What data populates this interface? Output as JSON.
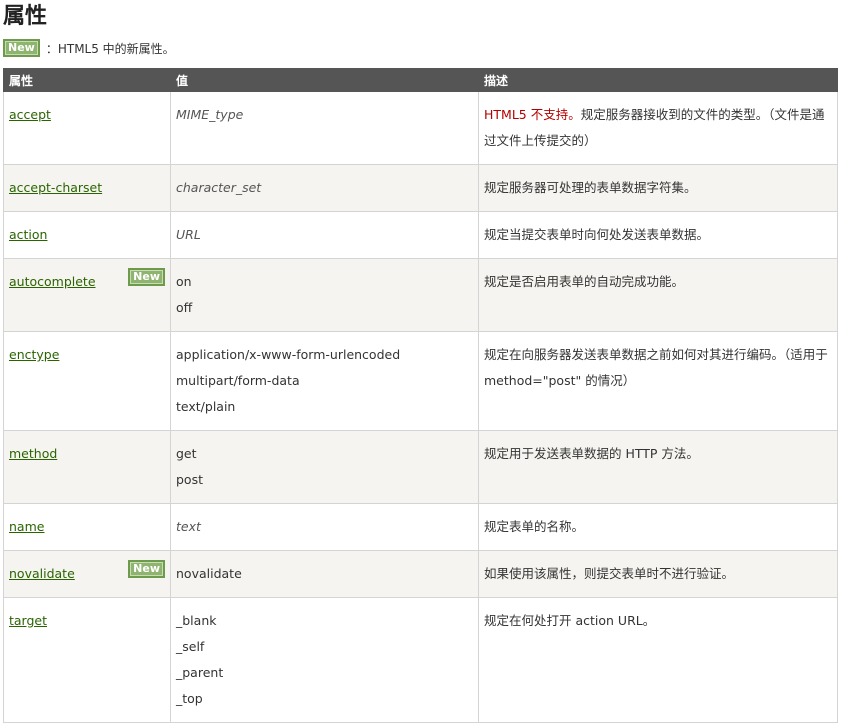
{
  "heading": "属性",
  "new_badge": "New",
  "note_text": "：HTML5 中的新属性。",
  "columns": [
    "属性",
    "值",
    "描述"
  ],
  "rows": [
    {
      "attr": "accept",
      "values": [
        "MIME_type"
      ],
      "italic": true,
      "desc_red": "HTML5 不支持。",
      "desc": "规定服务器接收到的文件的类型。（文件是通过文件上传提交的）",
      "is_new": false
    },
    {
      "attr": "accept-charset",
      "values": [
        "character_set"
      ],
      "italic": true,
      "desc_red": "",
      "desc": "规定服务器可处理的表单数据字符集。",
      "is_new": false
    },
    {
      "attr": "action",
      "values": [
        "URL"
      ],
      "italic": true,
      "desc_red": "",
      "desc": "规定当提交表单时向何处发送表单数据。",
      "is_new": false
    },
    {
      "attr": "autocomplete",
      "values": [
        "on",
        "off"
      ],
      "italic": false,
      "desc_red": "",
      "desc": "规定是否启用表单的自动完成功能。",
      "is_new": true
    },
    {
      "attr": "enctype",
      "values": [
        "application/x-www-form-urlencoded",
        "multipart/form-data",
        "text/plain"
      ],
      "italic": false,
      "desc_red": "",
      "desc": "规定在向服务器发送表单数据之前如何对其进行编码。（适用于 method=\"post\" 的情况）",
      "is_new": false
    },
    {
      "attr": "method",
      "values": [
        "get",
        "post"
      ],
      "italic": false,
      "desc_red": "",
      "desc": "规定用于发送表单数据的 HTTP 方法。",
      "is_new": false
    },
    {
      "attr": "name",
      "values": [
        "text"
      ],
      "italic": true,
      "desc_red": "",
      "desc": "规定表单的名称。",
      "is_new": false
    },
    {
      "attr": "novalidate",
      "values": [
        "novalidate"
      ],
      "italic": false,
      "desc_red": "",
      "desc": "如果使用该属性，则提交表单时不进行验证。",
      "is_new": true
    },
    {
      "attr": "target",
      "values": [
        "_blank",
        "_self",
        "_parent",
        "_top"
      ],
      "italic": false,
      "desc_red": "",
      "desc": "规定在何处打开 action URL。",
      "is_new": false
    }
  ],
  "colors": {
    "header_bg": "#555555",
    "alt_row_bg": "#f6f4f0",
    "link": "#2a6400",
    "badge": "#8fb46f",
    "warn": "#b40000"
  }
}
